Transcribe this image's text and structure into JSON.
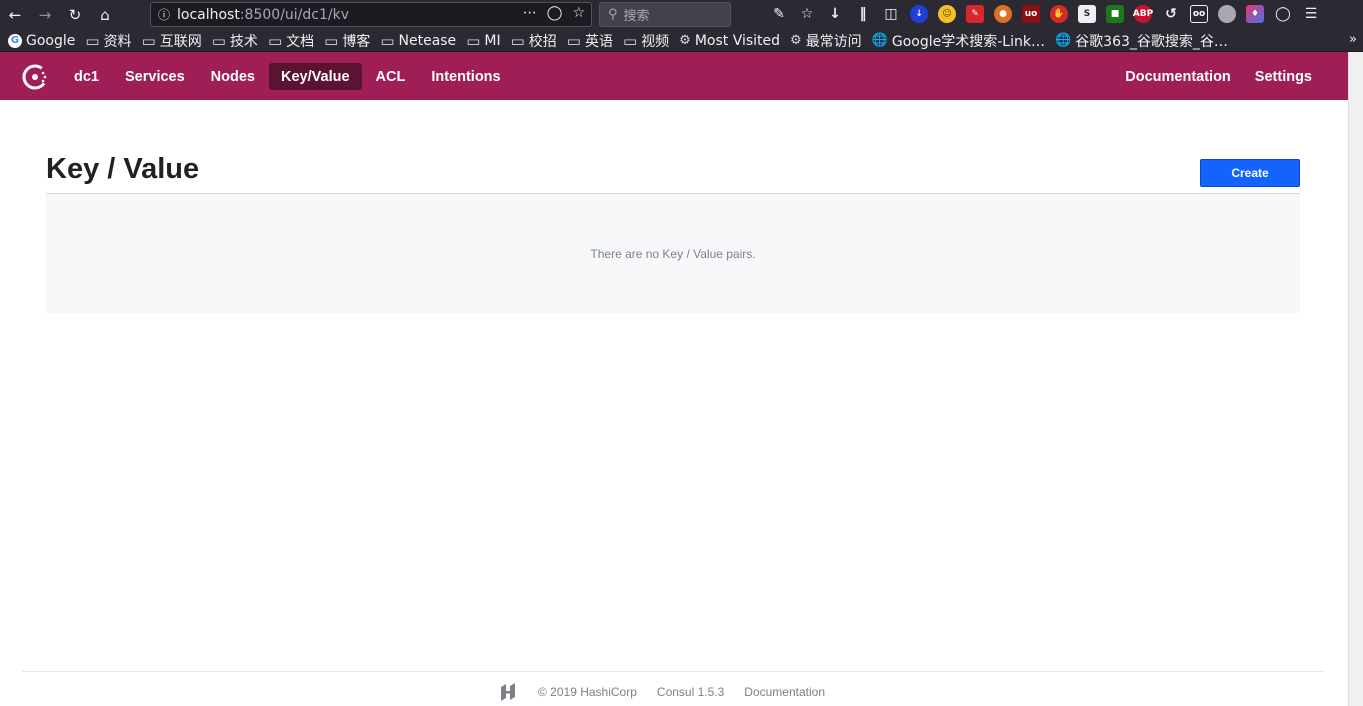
{
  "browser": {
    "url_host": "localhost",
    "url_rest": ":8500/ui/dc1/kv",
    "search_placeholder": "搜索",
    "bookmarks": [
      {
        "label": "Google",
        "icon": "google-icon"
      },
      {
        "label": "资料",
        "icon": "folder-icon"
      },
      {
        "label": "互联网",
        "icon": "folder-icon"
      },
      {
        "label": "技术",
        "icon": "folder-icon"
      },
      {
        "label": "文档",
        "icon": "folder-icon"
      },
      {
        "label": "博客",
        "icon": "folder-icon"
      },
      {
        "label": "Netease",
        "icon": "folder-icon"
      },
      {
        "label": "MI",
        "icon": "folder-icon"
      },
      {
        "label": "校招",
        "icon": "folder-icon"
      },
      {
        "label": "英语",
        "icon": "folder-icon"
      },
      {
        "label": "视频",
        "icon": "folder-icon"
      },
      {
        "label": "Most Visited",
        "icon": "gear-icon"
      },
      {
        "label": "最常访问",
        "icon": "gear-icon"
      },
      {
        "label": "Google学术搜索-Link…",
        "icon": "globe-icon"
      },
      {
        "label": "谷歌363_谷歌搜索_谷…",
        "icon": "globe-icon"
      }
    ],
    "more_label": "»"
  },
  "header": {
    "brand_color": "#a01e56",
    "active_color": "#5c1233",
    "nav": [
      {
        "label": "dc1",
        "active": false
      },
      {
        "label": "Services",
        "active": false
      },
      {
        "label": "Nodes",
        "active": false
      },
      {
        "label": "Key/Value",
        "active": true
      },
      {
        "label": "ACL",
        "active": false
      },
      {
        "label": "Intentions",
        "active": false
      }
    ],
    "nav_right": [
      {
        "label": "Documentation"
      },
      {
        "label": "Settings"
      }
    ]
  },
  "main": {
    "title": "Key / Value",
    "create_label": "Create",
    "empty_message": "There are no Key / Value pairs."
  },
  "footer": {
    "copyright": "© 2019 HashiCorp",
    "version": "Consul 1.5.3",
    "docs_label": "Documentation"
  }
}
